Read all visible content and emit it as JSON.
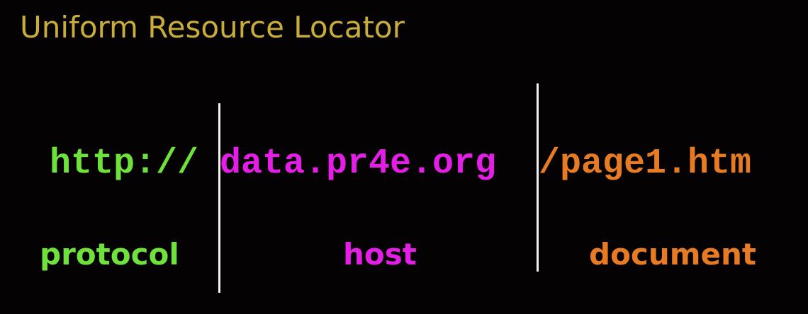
{
  "title": "Uniform Resource Locator",
  "url": {
    "protocol": "http://",
    "host": "data.pr4e.org",
    "document": "/page1.htm"
  },
  "labels": {
    "protocol": "protocol",
    "host": "host",
    "document": "document"
  },
  "colors": {
    "title": "#c8ad3a",
    "protocol": "#6ee23a",
    "host": "#e41ee6",
    "document": "#e77b24",
    "background": "#050203",
    "divider": "#f2f2f2"
  }
}
